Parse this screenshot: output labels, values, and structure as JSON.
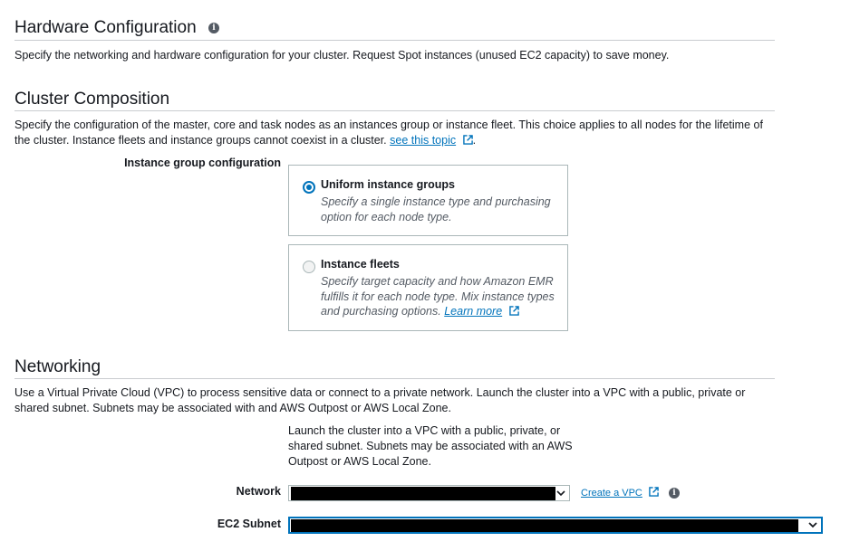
{
  "hardware": {
    "title": "Hardware Configuration",
    "info_icon": "info-icon",
    "description": "Specify the networking and hardware configuration for your cluster. Request Spot instances (unused EC2 capacity) to save money."
  },
  "cluster": {
    "title": "Cluster Composition",
    "description": "Specify the configuration of the master, core and task nodes as an instances group or instance fleet. This choice applies to all nodes for the lifetime of the cluster. Instance fleets and instance groups cannot coexist in a cluster.",
    "link_text": "see this topic",
    "period": ".",
    "field_label": "Instance group configuration",
    "options": [
      {
        "title": "Uniform instance groups",
        "description": "Specify a single instance type and purchasing option for each node type.",
        "selected": true
      },
      {
        "title": "Instance fleets",
        "description": "Specify target capacity and how Amazon EMR fulfills it for each node type. Mix instance types and purchasing options.",
        "link_text": "Learn more",
        "selected": false
      }
    ]
  },
  "networking": {
    "title": "Networking",
    "description": "Use a Virtual Private Cloud (VPC) to process sensitive data or connect to a private network. Launch the cluster into a VPC with a public, private or shared subnet. Subnets may be associated with and AWS Outpost or AWS Local Zone.",
    "helper": "Launch the cluster into a VPC with a public, private, or shared subnet. Subnets may be associated with an AWS Outpost or AWS Local Zone.",
    "network_label": "Network",
    "create_vpc_link": "Create a VPC",
    "subnet_label": "EC2 Subnet"
  },
  "colors": {
    "link": "#0073bb",
    "radio_selected": "#0073bb",
    "focus_border": "#0073bb",
    "redaction": "#000000"
  }
}
